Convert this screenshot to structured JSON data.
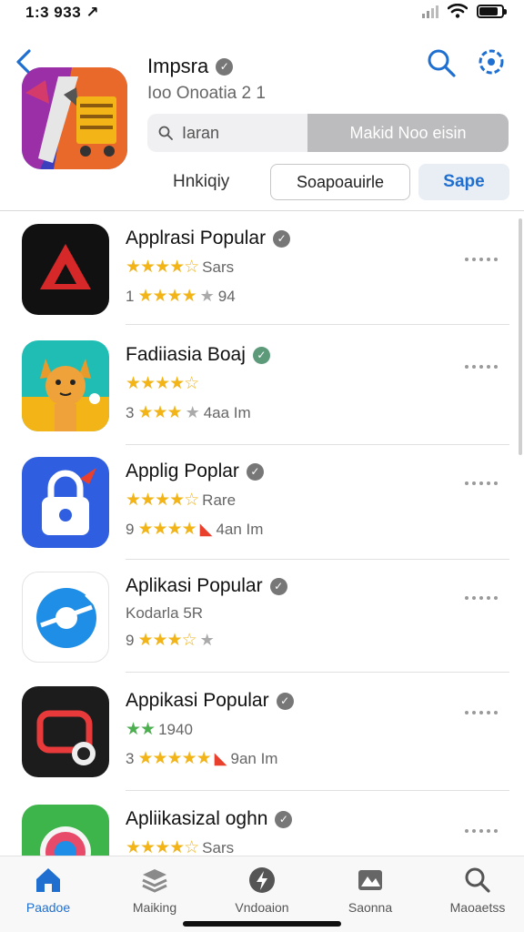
{
  "status_bar": {
    "time": "1:3 933 ↗"
  },
  "header": {
    "app_title": "Impsra",
    "app_subtitle": "Ioo Onoatia 2 1",
    "segmented": {
      "left_label": "Iaran",
      "right_label": "Makid Noo eisin"
    },
    "chips": {
      "plain": "Hnkiqiy",
      "outline": "Soapoauirle",
      "filled": "Sape"
    }
  },
  "apps": [
    {
      "title": "Applrasi Popular",
      "line1": "Sars",
      "line2_prefix": "1",
      "line2_suffix": "94",
      "line2_mark": "gray"
    },
    {
      "title": "Fadiiasia Boaj",
      "line1": "",
      "line2_prefix": "3",
      "line2_suffix": "4aa Im",
      "line2_mark": "gray"
    },
    {
      "title": "Applig Poplar",
      "line1": "Rare",
      "line2_prefix": "9",
      "line2_suffix": "4an Im",
      "line2_mark": "red"
    },
    {
      "title": "Aplikasi Popular",
      "line1": "Kodarla 5R",
      "line2_prefix": "9",
      "line2_suffix": "",
      "line2_mark": "gray"
    },
    {
      "title": "Appikasi Popular",
      "line1": "1940",
      "line2_prefix": "3",
      "line2_suffix": "9an Im",
      "line2_mark": "red"
    },
    {
      "title": "Apliikasizal oghn",
      "line1": "Sars",
      "line2_prefix": "",
      "line2_suffix": "",
      "line2_mark": ""
    }
  ],
  "tabs": [
    {
      "label": "Paadoe",
      "icon": "home-icon"
    },
    {
      "label": "Maiking",
      "icon": "stack-icon"
    },
    {
      "label": "Vndoaion",
      "icon": "bolt-icon"
    },
    {
      "label": "Saonna",
      "icon": "map-icon"
    },
    {
      "label": "Maoaetss",
      "icon": "search-icon"
    }
  ],
  "colors": {
    "accent": "#1f6fd1",
    "star": "#f2b417"
  }
}
